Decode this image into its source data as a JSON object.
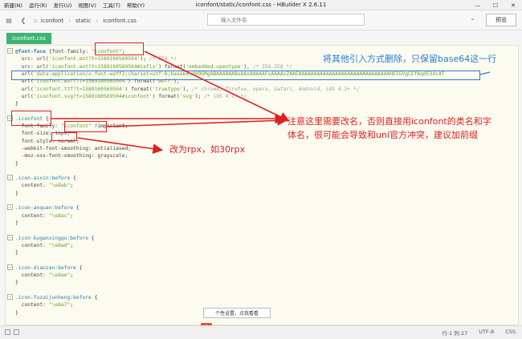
{
  "menu": {
    "items": [
      "新建(N)",
      "运行(R)",
      "发行(U)",
      "视图(V)",
      "工具(T)",
      "帮助(Y)"
    ],
    "window_title": "iconfont/static/iconfont.css - HBuilder X 2.6.11"
  },
  "toolbar": {
    "breadcrumb": [
      "iconfont",
      "static",
      "iconfont.css"
    ],
    "file_input_placeholder": "输入文件名",
    "preview_label": "预览"
  },
  "tab": {
    "label": "iconfont.css"
  },
  "code": {
    "lines": [
      {
        "fold": "⊟",
        "parts": [
          [
            "@font-face",
            "c-at"
          ],
          [
            " {font-family: ",
            "c-prop"
          ],
          [
            "\"iconfont\"",
            "c-str"
          ],
          [
            ";",
            "c-punc"
          ]
        ]
      },
      {
        "fold": "",
        "parts": [
          [
            "  src: url(",
            "c-prop"
          ],
          [
            "'iconfont.eot?t=1589160569504'",
            "c-str"
          ],
          [
            ");",
            "c-punc"
          ],
          [
            " /* IE9 */",
            "c-cmt"
          ]
        ]
      },
      {
        "fold": "",
        "parts": [
          [
            "  src: url(",
            "c-prop"
          ],
          [
            "'iconfont.eot?t=1589160569504#iefix'",
            "c-str"
          ],
          [
            ") format(",
            "c-prop"
          ],
          [
            "'embedded-opentype'",
            "c-str"
          ],
          [
            "), ",
            "c-punc"
          ],
          [
            "/* IE6-IE8 */",
            "c-cmt"
          ]
        ]
      },
      {
        "fold": "",
        "parts": [
          [
            "  url(",
            "c-prop"
          ],
          [
            "'data:application/x-font-woff2;charset=utf-8;base64,d09GMgABAAAAAABoAAsAAAAAFsAAAAsZAAEAAAAAAAAAAAAAAAAAAAAAAAAAAAAAAHEIGVgCEfAqd53dcAT",
            "c-str"
          ]
        ]
      },
      {
        "fold": "",
        "parts": [
          [
            "  url(",
            "c-prop"
          ],
          [
            "'iconfont.woff?t=1589160569504'",
            "c-str"
          ],
          [
            ") format(",
            "c-prop"
          ],
          [
            "'woff'",
            "c-str"
          ],
          [
            "),",
            "c-punc"
          ]
        ]
      },
      {
        "fold": "",
        "parts": [
          [
            "  url(",
            "c-prop"
          ],
          [
            "'iconfont.ttf?t=1589160569504'",
            "c-str"
          ],
          [
            ") format(",
            "c-prop"
          ],
          [
            "'truetype'",
            "c-str"
          ],
          [
            "), ",
            "c-punc"
          ],
          [
            "/* chrome, firefox, opera, Safari, Android, iOS 4.2+ */",
            "c-cmt"
          ]
        ]
      },
      {
        "fold": "",
        "parts": [
          [
            "  url(",
            "c-prop"
          ],
          [
            "'iconfont.svg?t=1589160569504#iconfont'",
            "c-str"
          ],
          [
            ") format(",
            "c-prop"
          ],
          [
            "'svg'",
            "c-str"
          ],
          [
            "); ",
            "c-punc"
          ],
          [
            "/* iOS 4.1- */",
            "c-cmt"
          ]
        ]
      },
      {
        "fold": "",
        "parts": [
          [
            "}",
            "c-punc"
          ]
        ]
      },
      {
        "fold": "",
        "parts": [
          [
            "",
            "c-punc"
          ]
        ]
      },
      {
        "fold": "⊟",
        "parts": [
          [
            ".iconfont",
            "c-sel"
          ],
          [
            " {",
            "c-punc"
          ]
        ]
      },
      {
        "fold": "",
        "parts": [
          [
            "  font-family: ",
            "c-prop"
          ],
          [
            "\"iconfont\"",
            "c-str"
          ],
          [
            " !important;",
            "c-punc"
          ]
        ]
      },
      {
        "fold": "",
        "parts": [
          [
            "  font-size: ",
            "c-prop"
          ],
          [
            "16px",
            "c-num"
          ],
          [
            ";",
            "c-punc"
          ]
        ]
      },
      {
        "fold": "",
        "parts": [
          [
            "  font-style: normal;",
            "c-prop"
          ]
        ]
      },
      {
        "fold": "",
        "parts": [
          [
            "  -webkit-font-smoothing: antialiased;",
            "c-prop"
          ]
        ]
      },
      {
        "fold": "",
        "parts": [
          [
            "  -moz-osx-font-smoothing: grayscale;",
            "c-prop"
          ]
        ]
      },
      {
        "fold": "",
        "parts": [
          [
            "}",
            "c-punc"
          ]
        ]
      },
      {
        "fold": "",
        "parts": [
          [
            "",
            "c-punc"
          ]
        ]
      },
      {
        "fold": "⊟",
        "parts": [
          [
            ".icon-aixin:before",
            "c-sel"
          ],
          [
            " {",
            "c-punc"
          ]
        ]
      },
      {
        "fold": "",
        "parts": [
          [
            "  content: ",
            "c-prop"
          ],
          [
            "\"\\e8ab\"",
            "c-str"
          ],
          [
            ";",
            "c-punc"
          ]
        ]
      },
      {
        "fold": "",
        "parts": [
          [
            "}",
            "c-punc"
          ]
        ]
      },
      {
        "fold": "",
        "parts": [
          [
            "",
            "c-punc"
          ]
        ]
      },
      {
        "fold": "⊟",
        "parts": [
          [
            ".icon-anquan:before",
            "c-sel"
          ],
          [
            " {",
            "c-punc"
          ]
        ]
      },
      {
        "fold": "",
        "parts": [
          [
            "  content: ",
            "c-prop"
          ],
          [
            "\"\\e8ac\"",
            "c-str"
          ],
          [
            ";",
            "c-punc"
          ]
        ]
      },
      {
        "fold": "",
        "parts": [
          [
            "}",
            "c-punc"
          ]
        ]
      },
      {
        "fold": "",
        "parts": [
          [
            "",
            "c-punc"
          ]
        ]
      },
      {
        "fold": "⊟",
        "parts": [
          [
            ".icon-buganxingqu:before",
            "c-sel"
          ],
          [
            " {",
            "c-punc"
          ]
        ]
      },
      {
        "fold": "",
        "parts": [
          [
            "  content: ",
            "c-prop"
          ],
          [
            "\"\\e8ad\"",
            "c-str"
          ],
          [
            ";",
            "c-punc"
          ]
        ]
      },
      {
        "fold": "",
        "parts": [
          [
            "}",
            "c-punc"
          ]
        ]
      },
      {
        "fold": "",
        "parts": [
          [
            "",
            "c-punc"
          ]
        ]
      },
      {
        "fold": "⊟",
        "parts": [
          [
            ".icon-dianzan:before",
            "c-sel"
          ],
          [
            " {",
            "c-punc"
          ]
        ]
      },
      {
        "fold": "",
        "parts": [
          [
            "  content: ",
            "c-prop"
          ],
          [
            "\"\\e8ae\"",
            "c-str"
          ],
          [
            ";",
            "c-punc"
          ]
        ]
      },
      {
        "fold": "",
        "parts": [
          [
            "}",
            "c-punc"
          ]
        ]
      },
      {
        "fold": "",
        "parts": [
          [
            "",
            "c-punc"
          ]
        ]
      },
      {
        "fold": "⊟",
        "parts": [
          [
            ".icon-fuzaijunheng:before",
            "c-sel"
          ],
          [
            " {",
            "c-punc"
          ]
        ]
      },
      {
        "fold": "",
        "parts": [
          [
            "  content: ",
            "c-prop"
          ],
          [
            "\"\\e6a7\"",
            "c-str"
          ],
          [
            ";",
            "c-punc"
          ]
        ]
      },
      {
        "fold": "",
        "parts": [
          [
            "}",
            "c-punc"
          ]
        ]
      }
    ]
  },
  "annotations": {
    "blue_note": "将其他引入方式删除，只保留base64这一行",
    "red_note_1_line1": "注意这里需要改名，否则直接用iconfont的类名和字",
    "red_note_1_line2": "体名，很可能会导致和uni官方冲突，建议加前缀",
    "red_note_2": "改为rpx，如30rpx"
  },
  "ime": {
    "logo": "S",
    "lang": "英",
    "tooltip": "个性设置，点我看看"
  },
  "status": {
    "position": "行:1  列:27",
    "encoding": "UTF-8",
    "language": "CSS"
  },
  "colors": {
    "annotation_red": "#e02020",
    "annotation_blue": "#2b7bd8",
    "tab_green": "#3cb371"
  }
}
